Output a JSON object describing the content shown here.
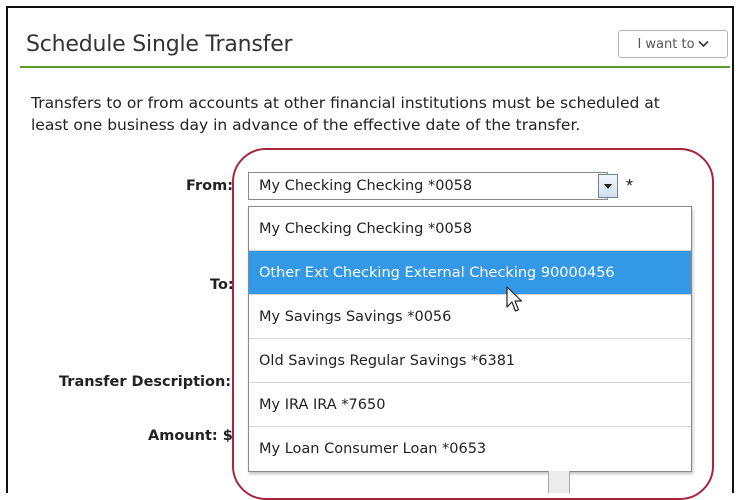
{
  "header": {
    "title": "Schedule Single Transfer",
    "menu_label": "I want to",
    "menu_icon": "chevron-down-icon"
  },
  "notice": "Transfers to or from accounts at other financial institutions must be scheduled at least one business day in advance of the effective date of the transfer.",
  "form": {
    "from_label": "From:",
    "to_label": "To:",
    "description_label": "Transfer Description:",
    "amount_label": "Amount: $",
    "from_value": "My Checking Checking *0058",
    "required_marker": "*"
  },
  "dropdown": {
    "options": [
      "My Checking Checking *0058",
      "Other Ext Checking External Checking 90000456",
      "My Savings Savings *0056",
      "Old Savings Regular Savings *6381",
      "My IRA IRA *7650",
      "My Loan Consumer Loan *0653"
    ],
    "highlighted": "Other Ext Checking External Checking 90000456"
  },
  "colors": {
    "accent_rule": "#5a9a2e",
    "option_highlight": "#3399e6",
    "annotation_ring": "#a8253a"
  }
}
